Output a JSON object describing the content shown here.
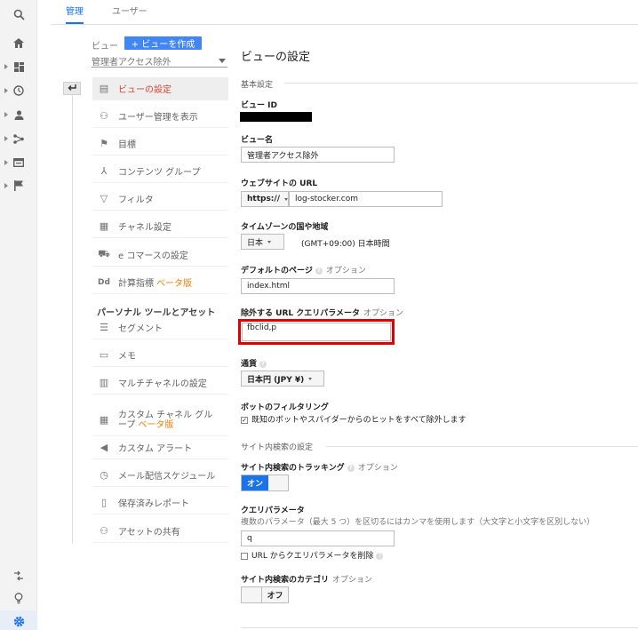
{
  "tabs": {
    "admin": "管理",
    "user": "ユーザー"
  },
  "view": {
    "label": "ビュー",
    "create_button": "+ ビューを作成",
    "selected": "管理者アクセス除外"
  },
  "nav": [
    {
      "label": "ビューの設定",
      "icon": "document-icon",
      "active": true
    },
    {
      "label": "ユーザー管理を表示",
      "icon": "users-icon"
    },
    {
      "label": "目標",
      "icon": "flag-icon"
    },
    {
      "label": "コンテンツ グループ",
      "icon": "content-group-icon"
    },
    {
      "label": "フィルタ",
      "icon": "filter-icon"
    },
    {
      "label": "チャネル設定",
      "icon": "channel-icon"
    },
    {
      "label": "e コマースの設定",
      "icon": "cart-icon"
    },
    {
      "label": "計算指標",
      "icon": "calculated-metrics-icon",
      "beta": "ベータ版"
    },
    {
      "label": "セグメント",
      "icon": "segment-icon"
    },
    {
      "label": "メモ",
      "icon": "memo-icon"
    },
    {
      "label": "マルチチャネルの設定",
      "icon": "bar-chart-icon"
    },
    {
      "label": "カスタム チャネル グループ",
      "icon": "custom-channel-icon",
      "beta": "ベータ版"
    },
    {
      "label": "カスタム アラート",
      "icon": "megaphone-icon"
    },
    {
      "label": "メール配信スケジュール",
      "icon": "clock-icon"
    },
    {
      "label": "保存済みレポート",
      "icon": "saved-report-icon"
    },
    {
      "label": "アセットの共有",
      "icon": "share-asset-icon"
    }
  ],
  "personal_section": "パーソナル ツールとアセット",
  "settings": {
    "title": "ビューの設定",
    "basic": "基本設定",
    "view_id_label": "ビュー ID",
    "view_name_label": "ビュー名",
    "view_name_value": "管理者アクセス除外",
    "url_label": "ウェブサイトの URL",
    "url_protocol": "https://",
    "url_value": "log-stocker.com",
    "timezone_label": "タイムゾーンの国や地域",
    "timezone_country": "日本",
    "timezone_value": "(GMT+09:00) 日本時間",
    "default_page_label": "デフォルトのページ",
    "optional": "オプション",
    "default_page_value": "index.html",
    "exclude_params_label": "除外する URL クエリパラメータ",
    "exclude_params_value": "fbclid,p",
    "currency_label": "通貨",
    "currency_value": "日本円 (JPY ¥)",
    "bot_label": "ボットのフィルタリング",
    "bot_checkbox": "既知のボットやスパイダーからのヒットをすべて除外します",
    "site_search_section": "サイト内検索の設定",
    "site_search_tracking_label": "サイト内検索のトラッキング",
    "on": "オン",
    "query_param_label": "クエリパラメータ",
    "query_param_desc": "複数のパラメータ（最大 5 つ）を区切るにはカンマを使用します（大文字と小文字を区別しない）",
    "query_param_value": "q",
    "remove_param_checkbox": "URL からクエリパラメータを削除",
    "category_label": "サイト内検索のカテゴリ",
    "off": "オフ"
  },
  "colors": {
    "accent": "#1a73e8",
    "highlight": "#e00000",
    "active_nav": "#db4437",
    "beta": "#f57c00"
  }
}
